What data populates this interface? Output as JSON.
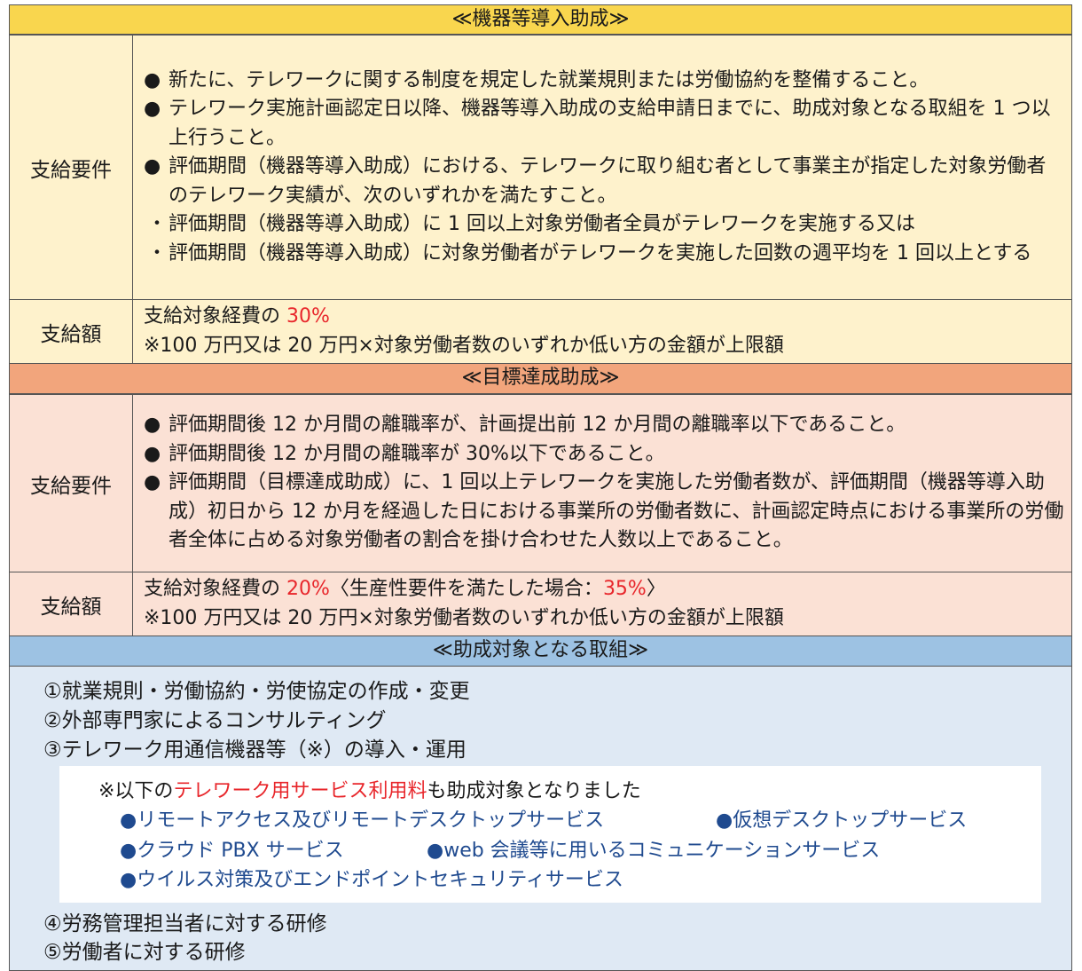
{
  "section1": {
    "title": "≪機器等導入助成≫",
    "req_label": "支給要件",
    "req_items": [
      {
        "marker": "●",
        "text": "新たに、テレワークに関する制度を規定した就業規則または労働協約を整備すること。"
      },
      {
        "marker": "●",
        "text": "テレワーク実施計画認定日以降、機器等導入助成の支給申請日までに、助成対象となる取組を 1 つ以上行うこと。"
      },
      {
        "marker": "●",
        "text": "評価期間（機器等導入助成）における、テレワークに取り組む者として事業主が指定した対象労働者のテレワーク実績が、次のいずれかを満たすこと。"
      },
      {
        "marker": "・",
        "text": "評価期間（機器等導入助成）に 1 回以上対象労働者全員がテレワークを実施する又は"
      },
      {
        "marker": "・",
        "text": "評価期間（機器等導入助成）に対象労働者がテレワークを実施した回数の週平均を 1 回以上とする"
      }
    ],
    "amt_label": "支給額",
    "amt_prefix": "支給対象経費の",
    "amt_rate": "30%",
    "amt_note": "※100 万円又は 20 万円×対象労働者数のいずれか低い方の金額が上限額"
  },
  "section2": {
    "title": "≪目標達成助成≫",
    "req_label": "支給要件",
    "req_items": [
      {
        "marker": "●",
        "text": "評価期間後 12 か月間の離職率が、計画提出前 12 か月間の離職率以下であること。"
      },
      {
        "marker": "●",
        "text": "評価期間後 12 か月間の離職率が 30%以下であること。"
      },
      {
        "marker": "●",
        "text": "評価期間（目標達成助成）に、1 回以上テレワークを実施した労働者数が、評価期間（機器等導入助成）初日から 12 か月を経過した日における事業所の労働者数に、計画認定時点における事業所の労働者全体に占める対象労働者の割合を掛け合わせた人数以上であること。"
      }
    ],
    "amt_label": "支給額",
    "amt_prefix": "支給対象経費の",
    "amt_rate": "20%",
    "amt_paren_open": "〈生産性要件を満たした場合：",
    "amt_rate2": "35%",
    "amt_paren_close": "〉",
    "amt_note": "※100 万円又は 20 万円×対象労働者数のいずれか低い方の金額が上限額"
  },
  "section3": {
    "title": "≪助成対象となる取組≫",
    "items": [
      "①就業規則・労働協約・労使協定の作成・変更",
      "②外部専門家によるコンサルティング",
      "③テレワーク用通信機器等（※）の導入・運用",
      "④労務管理担当者に対する研修",
      "⑤労働者に対する研修"
    ],
    "note_prefix": "※以下の",
    "note_highlight": "テレワーク用サービス利用料",
    "note_suffix": "も助成対象となりました",
    "services": [
      "●リモートアクセス及びリモートデスクトップサービス",
      "●仮想デスクトップサービス",
      "●クラウド PBX サービス",
      "●web 会議等に用いるコミュニケーションサービス",
      "●ウイルス対策及びエンドポイントセキュリティサービス"
    ]
  }
}
